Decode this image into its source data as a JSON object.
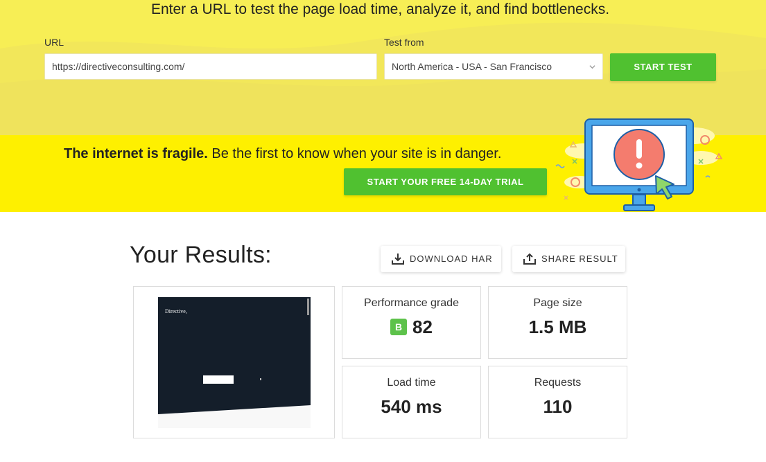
{
  "hero": {
    "headline": "Enter a URL to test the page load time, analyze it, and find bottlenecks.",
    "url_label": "URL",
    "url_value": "https://directiveconsulting.com/",
    "location_label": "Test from",
    "location_value": "North America - USA - San Francisco",
    "start_button": "START TEST"
  },
  "promo": {
    "bold_text": "The internet is fragile.",
    "text": " Be the first to know when your site is in danger.",
    "trial_button": "START YOUR FREE 14-DAY TRIAL"
  },
  "results": {
    "title": "Your Results:",
    "download_button": "DOWNLOAD HAR",
    "share_button": "SHARE RESULT",
    "screenshot_brand": "Directive,",
    "performance": {
      "label": "Performance grade",
      "grade": "B",
      "score": "82"
    },
    "page_size": {
      "label": "Page size",
      "value": "1.5 MB"
    },
    "load_time": {
      "label": "Load time",
      "value": "540 ms"
    },
    "requests": {
      "label": "Requests",
      "value": "110"
    }
  },
  "colors": {
    "hero_bg": "#f7ee55",
    "promo_bg": "#fef000",
    "green": "#50c130",
    "grade_badge": "#5dc24b"
  },
  "icons": [
    "chevron-down-icon",
    "download-icon",
    "share-icon",
    "monitor-alert-illustration"
  ]
}
